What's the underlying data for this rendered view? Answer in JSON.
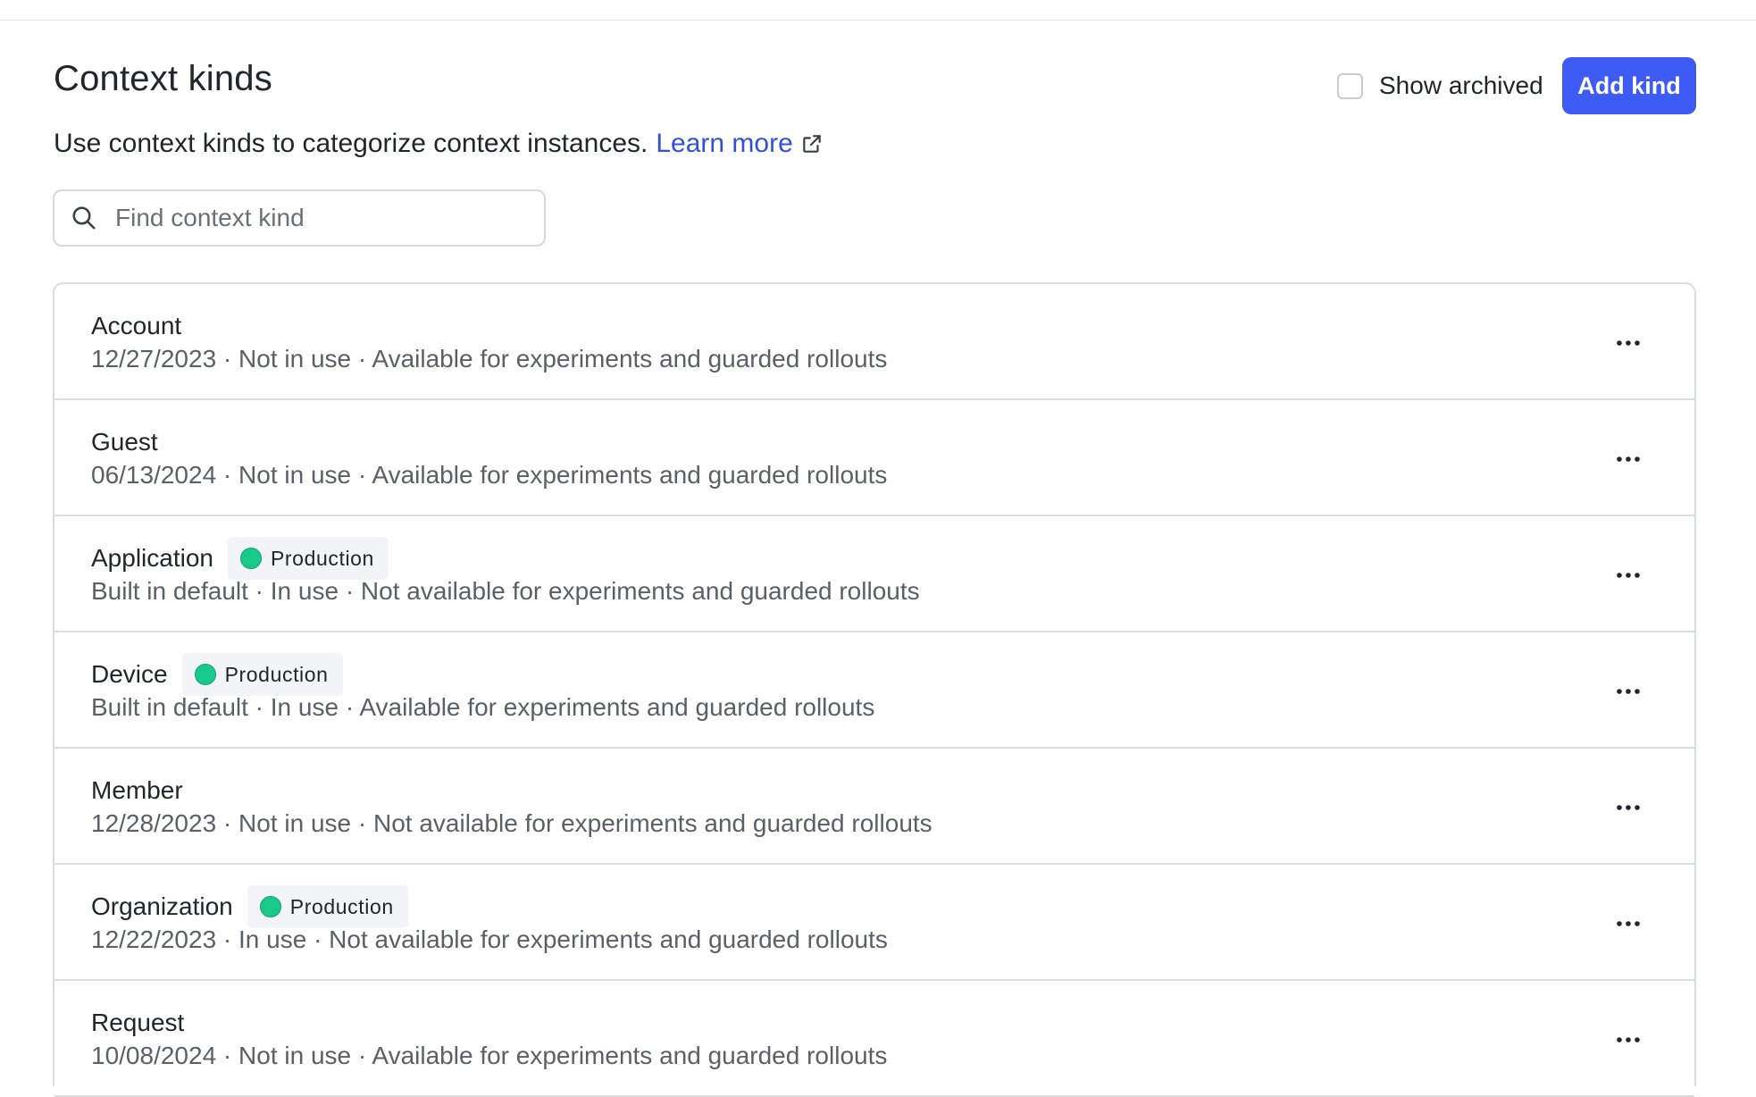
{
  "header": {
    "title": "Context kinds",
    "description": "Use context kinds to categorize context instances.",
    "learn_more": "Learn more",
    "show_archived": "Show archived",
    "add_button": "Add kind"
  },
  "search": {
    "placeholder": "Find context kind",
    "value": ""
  },
  "colors": {
    "accent": "#3e5bf5",
    "link": "#3350d6",
    "status_dot": "#18c98a"
  },
  "icons": {
    "search": "search-icon",
    "external": "external-link-icon",
    "more": "more-horizontal-icon"
  },
  "kinds": [
    {
      "name": "Account",
      "badge": "",
      "meta": "12/27/2023 · Not in use · Available for experiments and guarded rollouts"
    },
    {
      "name": "Guest",
      "badge": "",
      "meta": "06/13/2024 · Not in use · Available for experiments and guarded rollouts"
    },
    {
      "name": "Application",
      "badge": "Production",
      "meta": "Built in default · In use · Not available for experiments and guarded rollouts"
    },
    {
      "name": "Device",
      "badge": "Production",
      "meta": "Built in default · In use · Available for experiments and guarded rollouts"
    },
    {
      "name": "Member",
      "badge": "",
      "meta": "12/28/2023 · Not in use · Not available for experiments and guarded rollouts"
    },
    {
      "name": "Organization",
      "badge": "Production",
      "meta": "12/22/2023 · In use · Not available for experiments and guarded rollouts"
    },
    {
      "name": "Request",
      "badge": "",
      "meta": "10/08/2024 · Not in use · Available for experiments and guarded rollouts"
    }
  ]
}
